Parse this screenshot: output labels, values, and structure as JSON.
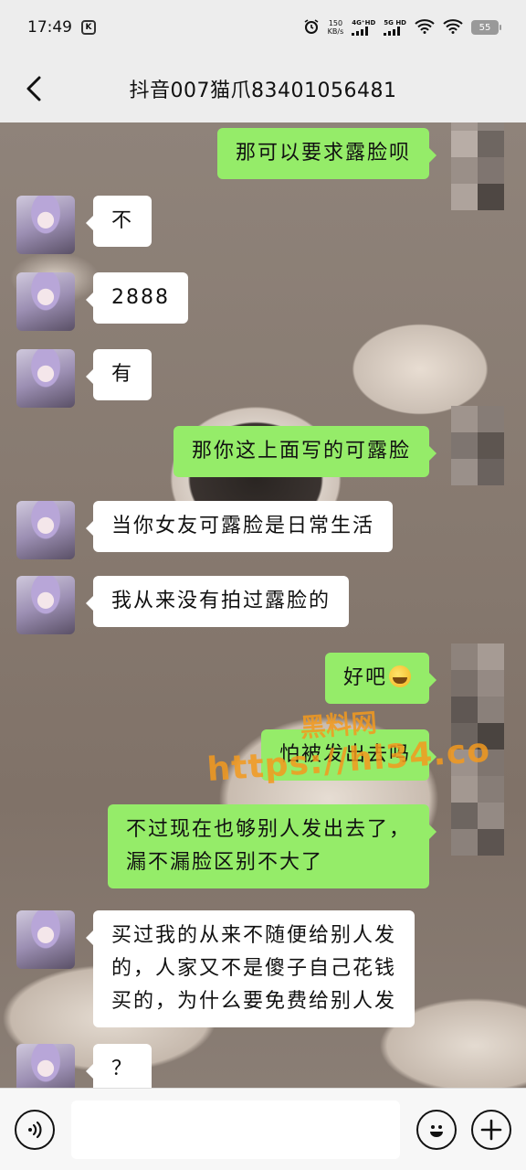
{
  "status_bar": {
    "time": "17:49",
    "speed_value": "150",
    "speed_unit": "KB/s",
    "network_1": "4G⁺HD",
    "network_2": "5G HD",
    "battery": "55"
  },
  "header": {
    "title": "抖音007猫爪83401056481"
  },
  "messages": [
    {
      "side": "right",
      "text": "那可以要求露脸呗"
    },
    {
      "side": "left",
      "text": "不"
    },
    {
      "side": "left",
      "text": "2888"
    },
    {
      "side": "left",
      "text": "有"
    },
    {
      "side": "right",
      "text": "那你这上面写的可露脸"
    },
    {
      "side": "left",
      "text": "当你女友可露脸是日常生活"
    },
    {
      "side": "left",
      "text": "我从来没有拍过露脸的"
    },
    {
      "side": "right",
      "text": "好吧",
      "emoji": "grimace-emoji"
    },
    {
      "side": "right",
      "text": "怕被发出去吗"
    },
    {
      "side": "right",
      "text": "不过现在也够别人发出去了，\n漏不漏脸区别不大了"
    },
    {
      "side": "left",
      "text": "买过我的从来不随便给别人发\n的，人家又不是傻子自己花钱\n买的，为什么要免费给别人发"
    },
    {
      "side": "left",
      "text": "？"
    }
  ],
  "watermark": {
    "top": "黑料网",
    "url": "https://hl34.co"
  },
  "input_bar": {
    "placeholder": "",
    "voice_icon": "voice-icon",
    "emoji_icon": "smiley-icon",
    "plus_icon": "plus-icon"
  },
  "colors": {
    "own_bubble": "#95ec69",
    "other_bubble": "#ffffff",
    "watermark": "#f39a1e",
    "bar_background": "#ededed"
  }
}
